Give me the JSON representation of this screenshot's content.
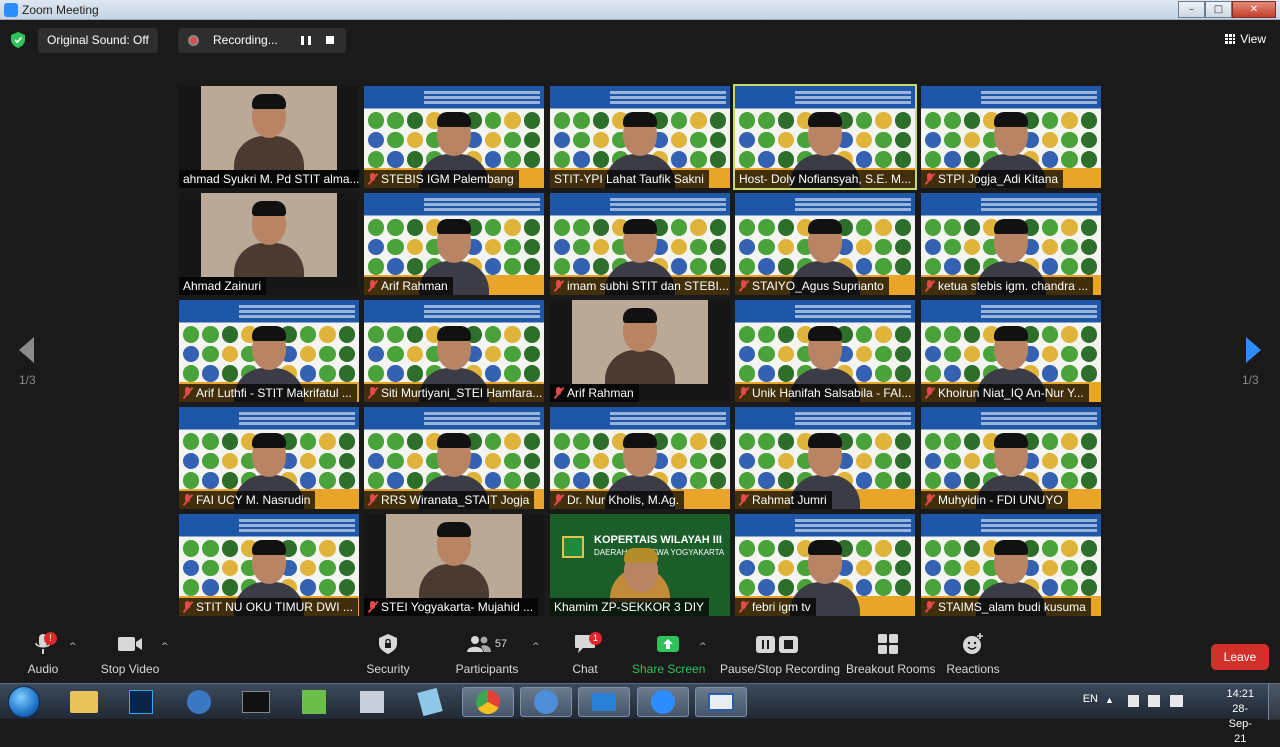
{
  "window": {
    "title": "Zoom Meeting",
    "minimize": "–",
    "maximize": "□",
    "close": "✕"
  },
  "topbar": {
    "original_sound_label": "Original Sound: Off",
    "recording_label": "Recording...",
    "view_label": "View"
  },
  "pagination": {
    "left_indicator": "1/3",
    "right_indicator": "1/3"
  },
  "tiles": [
    {
      "name": "ahmad Syukri M. Pd STIT alma...",
      "type": "camera",
      "muted": false
    },
    {
      "name": "STEBIS IGM Palembang",
      "type": "slide",
      "muted": true
    },
    {
      "name": "STIT-YPI Lahat Taufik Sakni",
      "type": "slide",
      "muted": false
    },
    {
      "name": "Host- Doly Nofiansyah, S.E. M...",
      "type": "slide",
      "muted": false,
      "active": true
    },
    {
      "name": "STPI Jogja_Adi Kitana",
      "type": "slide",
      "muted": true
    },
    {
      "name": "Ahmad Zainuri",
      "type": "camera",
      "muted": false
    },
    {
      "name": "Arif Rahman",
      "type": "slide",
      "muted": true
    },
    {
      "name": "imam subhi STIT dan STEBI...",
      "type": "slide",
      "muted": true
    },
    {
      "name": "STAIYO_Agus Suprianto",
      "type": "slide",
      "muted": true
    },
    {
      "name": "ketua stebis igm. chandra ...",
      "type": "slide",
      "muted": true
    },
    {
      "name": "Arif Luthfi - STIT Makrifatul ...",
      "type": "slide",
      "muted": true
    },
    {
      "name": "Siti Murtiyani_STEI Hamfara...",
      "type": "slide",
      "muted": true
    },
    {
      "name": "Arif Rahman",
      "type": "camera",
      "muted": true
    },
    {
      "name": "Unik Hanifah Salsabila - FAI...",
      "type": "slide",
      "muted": true
    },
    {
      "name": "Khoirun Niat_IQ An-Nur Y...",
      "type": "slide",
      "muted": true
    },
    {
      "name": "FAI UCY M. Nasrudin",
      "type": "slide",
      "muted": true
    },
    {
      "name": "RRS Wiranata_STAIT Jogja",
      "type": "slide",
      "muted": true
    },
    {
      "name": "Dr. Nur Kholis, M.Ag.",
      "type": "slide",
      "muted": true
    },
    {
      "name": "Rahmat Jumri",
      "type": "slide",
      "muted": true
    },
    {
      "name": "Muhyidin - FDI UNUYO",
      "type": "slide",
      "muted": true
    },
    {
      "name": "STIT NU OKU TIMUR DWI ...",
      "type": "slide",
      "muted": true
    },
    {
      "name": "STEI Yogyakarta- Mujahid ...",
      "type": "camera",
      "muted": true
    },
    {
      "name": "Khamim ZP-SEKKOR 3 DIY",
      "type": "banner",
      "muted": false,
      "banner_line1": "KOPERTAIS WILAYAH III",
      "banner_line2": "DAERAH ISTIMEWA YOGYAKARTA"
    },
    {
      "name": "febri igm tv",
      "type": "slide",
      "muted": true
    },
    {
      "name": "STAIMS_alam budi kusuma",
      "type": "slide",
      "muted": true
    }
  ],
  "toolbar": {
    "audio": {
      "label": "Audio",
      "badge": "!"
    },
    "stop_video": {
      "label": "Stop Video"
    },
    "security": {
      "label": "Security"
    },
    "participants": {
      "label": "Participants",
      "count": "57"
    },
    "chat": {
      "label": "Chat",
      "badge": "1"
    },
    "share_screen": {
      "label": "Share Screen"
    },
    "pause_stop_recording": {
      "label": "Pause/Stop Recording"
    },
    "breakout_rooms": {
      "label": "Breakout Rooms"
    },
    "reactions": {
      "label": "Reactions"
    },
    "leave": {
      "label": "Leave"
    }
  },
  "taskbar": {
    "language": "EN",
    "time": "14:21",
    "date": "28-Sep-21"
  },
  "colors": {
    "zoom_blue": "#2d8cff",
    "share_green": "#2fc25b",
    "leave_red": "#d3302c",
    "active_speaker": "#c8d86a"
  }
}
